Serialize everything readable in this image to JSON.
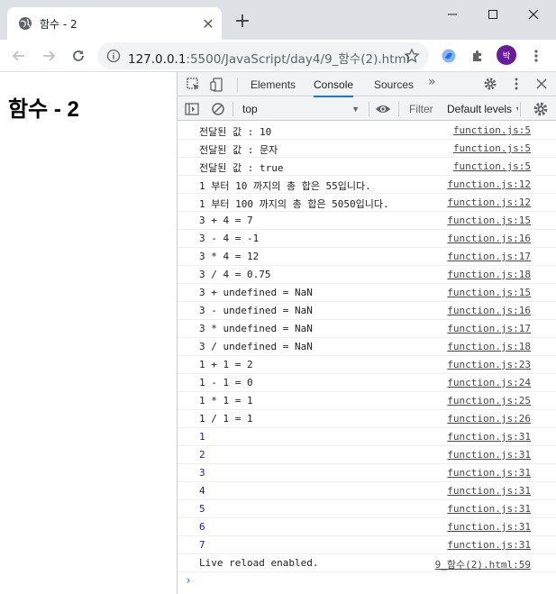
{
  "browser": {
    "tab_title": "함수 - 2",
    "url_host": "127.0.0.1",
    "url_path": ":5500/JavaScript/day4/9_함수(2).html",
    "avatar_label": "박"
  },
  "page": {
    "heading": "함수 - 2"
  },
  "devtools": {
    "tabs": [
      "Elements",
      "Console",
      "Sources"
    ],
    "active_tab": "Console",
    "context": "top",
    "filter_placeholder": "Filter",
    "levels": "Default levels",
    "log": [
      {
        "msg": "전달된 값 : 10",
        "src": "function.js:5",
        "kind": "text"
      },
      {
        "msg": "전달된 값 : 문자",
        "src": "function.js:5",
        "kind": "text"
      },
      {
        "msg": "전달된 값 : true",
        "src": "function.js:5",
        "kind": "text"
      },
      {
        "msg": "1 부터 10 까지의 총 합은 55입니다.",
        "src": "function.js:12",
        "kind": "text"
      },
      {
        "msg": "1 부터 100 까지의 총 합은 5050입니다.",
        "src": "function.js:12",
        "kind": "text"
      },
      {
        "msg": "3 + 4 = 7",
        "src": "function.js:15",
        "kind": "text"
      },
      {
        "msg": "3 - 4 = -1",
        "src": "function.js:16",
        "kind": "text"
      },
      {
        "msg": "3 * 4 = 12",
        "src": "function.js:17",
        "kind": "text"
      },
      {
        "msg": "3 / 4 = 0.75",
        "src": "function.js:18",
        "kind": "text"
      },
      {
        "msg": "3 + undefined = NaN",
        "src": "function.js:15",
        "kind": "text"
      },
      {
        "msg": "3 - undefined = NaN",
        "src": "function.js:16",
        "kind": "text"
      },
      {
        "msg": "3 * undefined = NaN",
        "src": "function.js:17",
        "kind": "text"
      },
      {
        "msg": "3 / undefined = NaN",
        "src": "function.js:18",
        "kind": "text"
      },
      {
        "msg": "1 + 1 = 2",
        "src": "function.js:23",
        "kind": "text"
      },
      {
        "msg": "1 - 1 = 0",
        "src": "function.js:24",
        "kind": "text"
      },
      {
        "msg": "1 * 1 = 1",
        "src": "function.js:25",
        "kind": "text"
      },
      {
        "msg": "1 / 1 = 1",
        "src": "function.js:26",
        "kind": "text"
      },
      {
        "msg": "1",
        "src": "function.js:31",
        "kind": "num"
      },
      {
        "msg": "2",
        "src": "function.js:31",
        "kind": "num"
      },
      {
        "msg": "3",
        "src": "function.js:31",
        "kind": "num"
      },
      {
        "msg": "4",
        "src": "function.js:31",
        "kind": "num"
      },
      {
        "msg": "5",
        "src": "function.js:31",
        "kind": "num"
      },
      {
        "msg": "6",
        "src": "function.js:31",
        "kind": "num"
      },
      {
        "msg": "7",
        "src": "function.js:31",
        "kind": "num"
      },
      {
        "msg": "Live reload enabled.",
        "src": "9_함수(2).html:59",
        "kind": "text"
      }
    ]
  }
}
